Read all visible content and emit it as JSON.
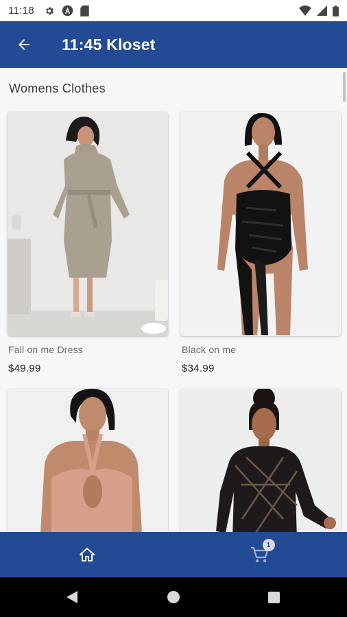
{
  "status_bar": {
    "time": "11:18"
  },
  "app_bar": {
    "title": "11:45 Kloset"
  },
  "section": {
    "title": "Womens Clothes"
  },
  "products": [
    {
      "name": "Fall on me Dress",
      "price": "$49.99"
    },
    {
      "name": "Black on me",
      "price": "$34.99"
    },
    {
      "name": "",
      "price": ""
    },
    {
      "name": "",
      "price": ""
    }
  ],
  "cart": {
    "count": "1"
  },
  "colors": {
    "primary": "#234b95",
    "background": "#f7f7f7"
  },
  "icons": [
    "back-arrow-icon",
    "home-icon",
    "cart-icon"
  ]
}
